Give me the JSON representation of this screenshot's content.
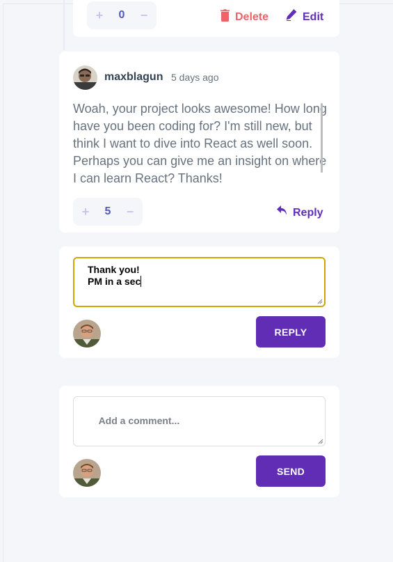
{
  "top_comment": {
    "score": "0",
    "plus": "+",
    "minus": "−",
    "delete_label": "Delete",
    "edit_label": "Edit"
  },
  "reply_comment": {
    "username": "maxblagun",
    "timestamp": "5 days ago",
    "body": "Woah, your project looks awesome! How long have you been coding for? I'm still new, but think I want to dive into React as well soon. Perhaps you can give me an insight on where I can learn React? Thanks!",
    "score": "5",
    "plus": "+",
    "minus": "−",
    "reply_label": "Reply"
  },
  "reply_form": {
    "value": "Thank you!\nPM in a sec",
    "button_label": "REPLY"
  },
  "new_comment_form": {
    "placeholder": "Add a comment...",
    "button_label": "SEND"
  },
  "icons": {
    "delete": "trash-icon",
    "edit": "pencil-icon",
    "reply": "reply-arrow-icon"
  },
  "colors": {
    "accent": "#5f2fb9",
    "danger": "#ed6368",
    "focus_border": "#d4a300"
  }
}
